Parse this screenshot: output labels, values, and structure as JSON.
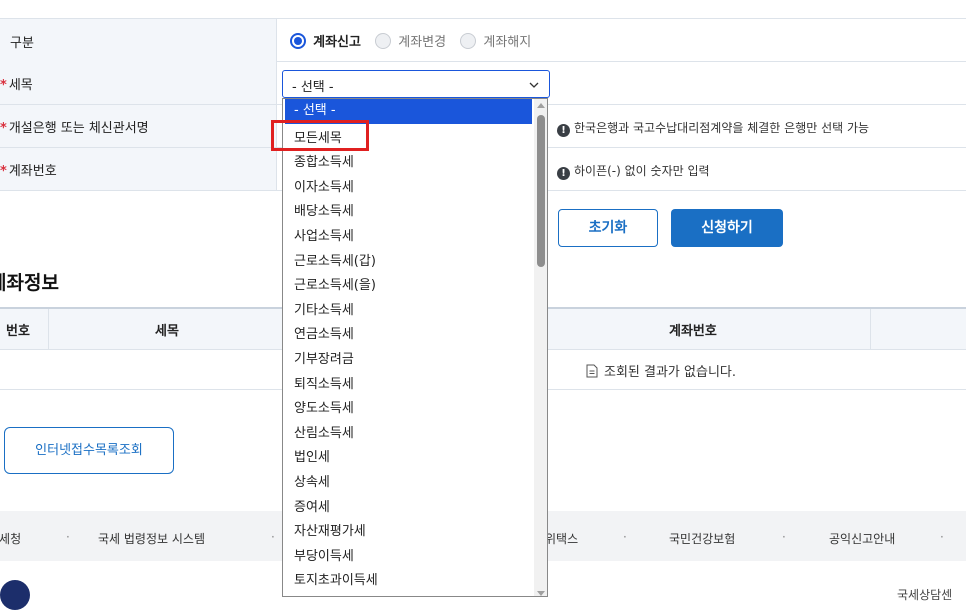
{
  "form": {
    "type_label": "구분",
    "radio_options": [
      "계좌신고",
      "계좌변경",
      "계좌해지"
    ],
    "tax_label": "세목",
    "bank_label": "개설은행 또는 체신관서명",
    "account_label": "계좌번호",
    "select_value": "- 선택 -",
    "bank_hint": "한국은행과 국고수납대리점계약을 체결한 은행만 선택 가능",
    "account_hint": "하이픈(-) 없이 숫자만 입력",
    "required_mark": "*"
  },
  "buttons": {
    "reset": "초기화",
    "apply": "신청하기",
    "list": "인터넷접수목록조회"
  },
  "section": {
    "title": "계좌정보",
    "columns": [
      "번호",
      "세목",
      "계좌번호"
    ],
    "empty_message": "조회된 결과가 없습니다."
  },
  "dropdown": {
    "options": [
      "- 선택 -",
      "모든세목",
      "종합소득세",
      "이자소득세",
      "배당소득세",
      "사업소득세",
      "근로소득세(갑)",
      "근로소득세(을)",
      "기타소득세",
      "연금소득세",
      "기부장려금",
      "퇴직소득세",
      "양도소득세",
      "산림소득세",
      "법인세",
      "상속세",
      "증여세",
      "자산재평가세",
      "부당이득세",
      "토지초과이득세"
    ],
    "selected": 0,
    "highlighted": 1
  },
  "footer": {
    "links": [
      "국세청",
      "국세 법령정보 시스템",
      "위택스",
      "국민건강보험",
      "공익신고안내"
    ],
    "right_text": "국세상담센"
  },
  "colors": {
    "accent": "#1a56db",
    "primary_button": "#1a6fc4",
    "highlight_box": "#e02020"
  }
}
